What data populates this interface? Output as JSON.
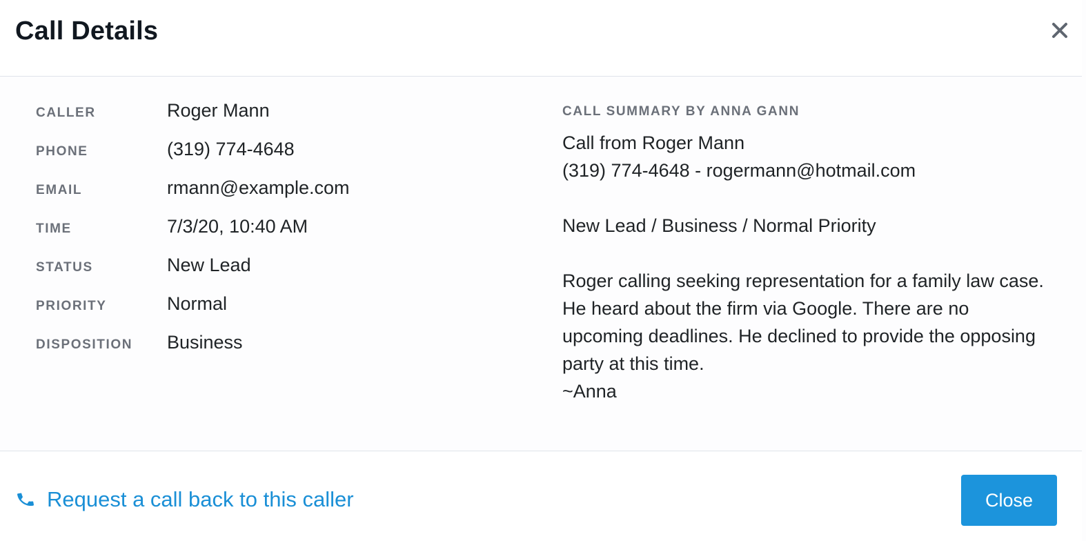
{
  "dialog": {
    "title": "Call Details",
    "close_icon": "close-icon"
  },
  "details": [
    {
      "label": "CALLER",
      "value": "Roger Mann"
    },
    {
      "label": "PHONE",
      "value": "(319) 774-4648"
    },
    {
      "label": "EMAIL",
      "value": "rmann@example.com"
    },
    {
      "label": "TIME",
      "value": "7/3/20, 10:40 AM"
    },
    {
      "label": "STATUS",
      "value": "New Lead"
    },
    {
      "label": "PRIORITY",
      "value": "Normal"
    },
    {
      "label": "DISPOSITION",
      "value": "Business"
    }
  ],
  "summary": {
    "heading": "CALL SUMMARY BY ANNA GANN",
    "line1": "Call from Roger Mann",
    "line2": "(319) 774-4648 - rogermann@hotmail.com",
    "tags": "New Lead / Business / Normal Priority",
    "body": "Roger calling seeking representation for a family law case. He heard about the firm via Google. There are no upcoming deadlines. He declined to provide the opposing party at this time.",
    "signoff": "~Anna"
  },
  "footer": {
    "callback_label": "Request a call back to this caller",
    "callback_icon": "phone-icon",
    "close_label": "Close"
  },
  "colors": {
    "accent": "#1a8fd6",
    "button": "#1c94dc",
    "label": "#6b7079",
    "divider": "#dfe3ea"
  }
}
